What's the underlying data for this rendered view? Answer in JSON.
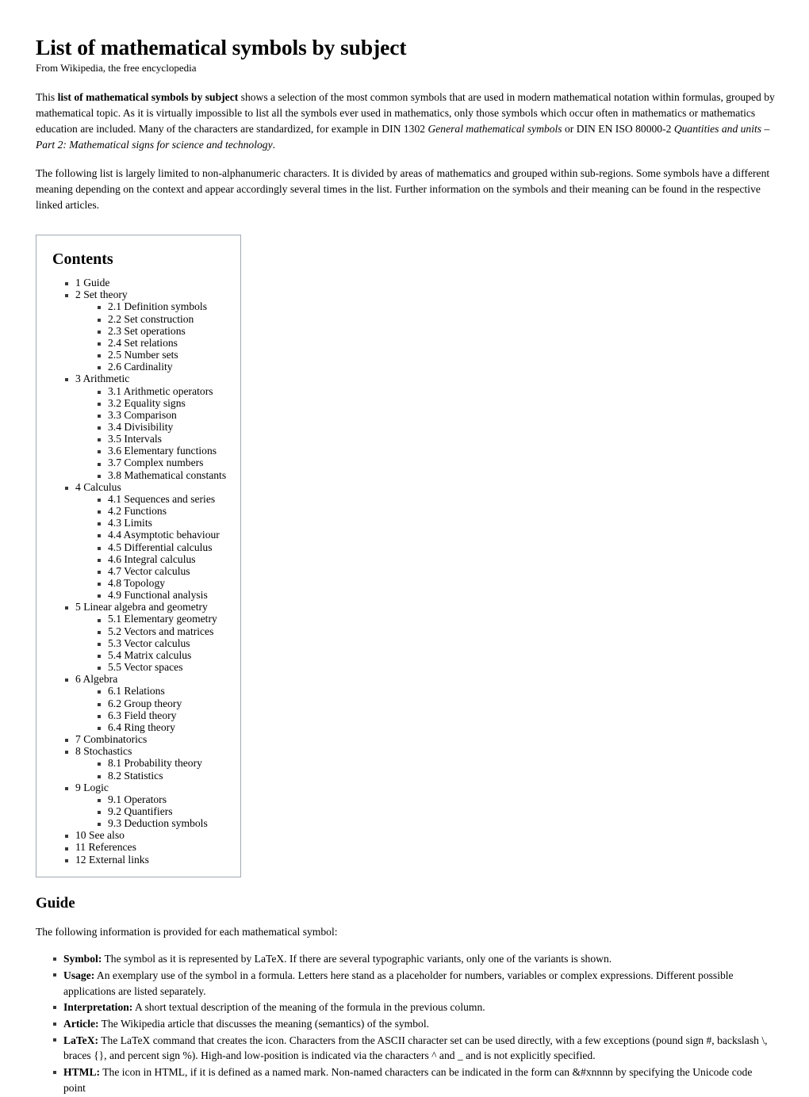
{
  "article": {
    "title": "List of mathematical symbols by subject",
    "subtitle": "From Wikipedia, the free encyclopedia",
    "intro_paragraph_1": {
      "part_1": "This ",
      "bold_1": "list of mathematical symbols by subject",
      "part_2": " shows a selection of the most common symbols that are used in modern mathematical notation within formulas, grouped by mathematical topic. As it is virtually impossible to list all the symbols ever used in mathematics, only those symbols which occur often in mathematics or mathematics education are included. Many of the characters are standardized, for example in DIN 1302 ",
      "italic_1": "General mathematical symbols",
      "part_3": " or DIN EN ISO 80000-2 ",
      "italic_2": "Quantities and units – Part 2: Mathematical signs for science and technology",
      "part_4": "."
    },
    "intro_paragraph_2": "The following list is largely limited to non-alphanumeric characters. It is divided by areas of mathematics and grouped within sub-regions. Some symbols have a different meaning depending on the context and appear accordingly several times in the list. Further information on the symbols and their meaning can be found in the respective linked articles."
  },
  "toc": {
    "title": "Contents",
    "items": [
      {
        "label": "1 Guide",
        "children": []
      },
      {
        "label": "2 Set theory",
        "children": [
          "2.1 Definition symbols",
          "2.2 Set construction",
          "2.3 Set operations",
          "2.4 Set relations",
          "2.5 Number sets",
          "2.6 Cardinality"
        ]
      },
      {
        "label": "3 Arithmetic",
        "children": [
          "3.1 Arithmetic operators",
          "3.2 Equality signs",
          "3.3 Comparison",
          "3.4 Divisibility",
          "3.5 Intervals",
          "3.6 Elementary functions",
          "3.7 Complex numbers",
          "3.8 Mathematical constants"
        ]
      },
      {
        "label": "4 Calculus",
        "children": [
          "4.1 Sequences and series",
          "4.2 Functions",
          "4.3 Limits",
          "4.4 Asymptotic behaviour",
          "4.5 Differential calculus",
          "4.6 Integral calculus",
          "4.7 Vector calculus",
          "4.8 Topology",
          "4.9 Functional analysis"
        ]
      },
      {
        "label": "5 Linear algebra and geometry",
        "children": [
          "5.1 Elementary geometry",
          "5.2 Vectors and matrices",
          "5.3 Vector calculus",
          "5.4 Matrix calculus",
          "5.5 Vector spaces"
        ]
      },
      {
        "label": "6 Algebra",
        "children": [
          "6.1 Relations",
          "6.2 Group theory",
          "6.3 Field theory",
          "6.4 Ring theory"
        ]
      },
      {
        "label": "7 Combinatorics",
        "children": []
      },
      {
        "label": "8 Stochastics",
        "children": [
          "8.1 Probability theory",
          "8.2 Statistics"
        ]
      },
      {
        "label": "9 Logic",
        "children": [
          "9.1 Operators",
          "9.2 Quantifiers",
          "9.3 Deduction symbols"
        ]
      },
      {
        "label": "10 See also",
        "children": []
      },
      {
        "label": "11 References",
        "children": []
      },
      {
        "label": "12 External links",
        "children": []
      }
    ]
  },
  "guide": {
    "heading": "Guide",
    "intro": "The following information is provided for each mathematical symbol:",
    "items": [
      {
        "term": "Symbol:",
        "description": " The symbol as it is represented by LaTeX. If there are several typographic variants, only one of the variants is shown."
      },
      {
        "term": "Usage:",
        "description": " An exemplary use of the symbol in a formula. Letters here stand as a placeholder for numbers, variables or complex expressions. Different possible applications are listed separately."
      },
      {
        "term": "Interpretation:",
        "description": " A short textual description of the meaning of the formula in the previous column."
      },
      {
        "term": "Article:",
        "description": " The Wikipedia article that discusses the meaning (semantics) of the symbol."
      },
      {
        "term": "LaTeX:",
        "description": " The LaTeX command that creates the icon. Characters from the ASCII character set can be used directly, with a few exceptions (pound sign #, backslash \\, braces {}, and percent sign %). High-and low-position is indicated via the characters ^ and _ and is not explicitly specified."
      },
      {
        "term": "HTML:",
        "description": " The icon in HTML, if it is defined as a named mark. Non-named characters can be indicated in the form can &#xnnnn by specifying the Unicode code point"
      }
    ]
  }
}
